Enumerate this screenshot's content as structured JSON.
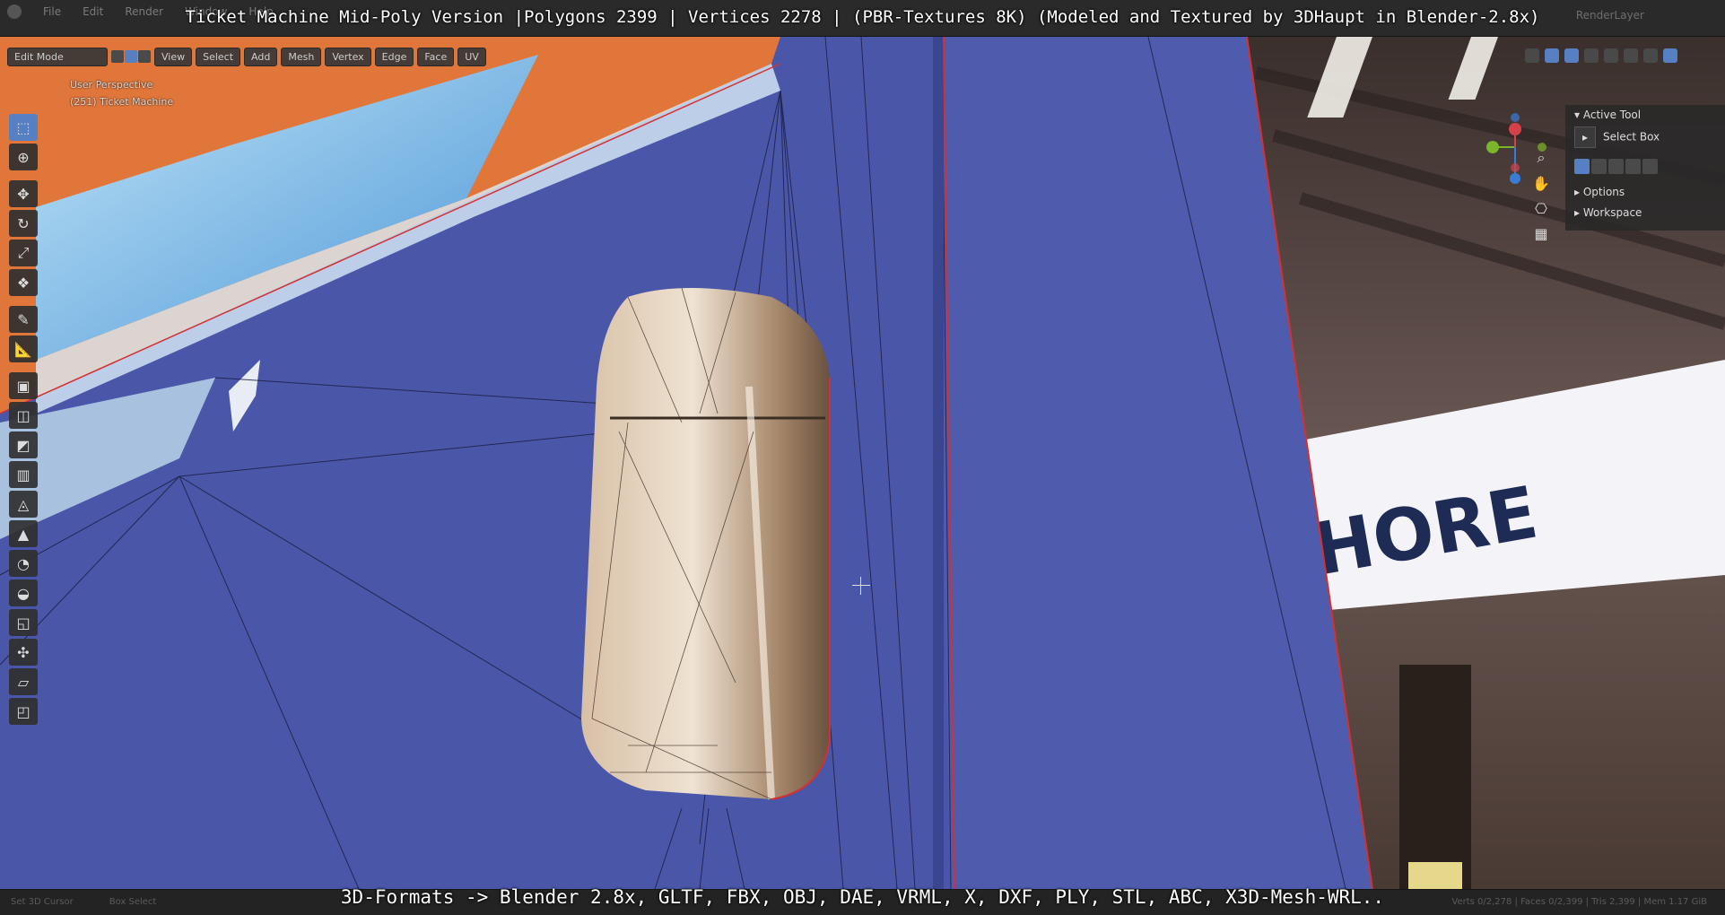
{
  "overlay": {
    "title": "Ticket Machine Mid-Poly Version |Polygons 2399 | Vertices 2278 | (PBR-Textures 8K) (Modeled and Textured by 3DHaupt in Blender-2.8x)",
    "formats": "3D-Formats -> Blender 2.8x, GLTF, FBX, OBJ, DAE, VRML, X, DXF, PLY, STL, ABC, X3D-Mesh-WRL.."
  },
  "menu": {
    "items": [
      "File",
      "Edit",
      "Render",
      "Window",
      "Help"
    ]
  },
  "top_right": {
    "renderlayer": "RenderLayer"
  },
  "header": {
    "mode": "Edit Mode",
    "buttons": [
      "View",
      "Select",
      "Add",
      "Mesh",
      "Vertex",
      "Edge",
      "Face",
      "UV"
    ]
  },
  "viewport": {
    "perspective": "User Perspective",
    "object": "(251) Ticket Machine",
    "sign_text": "HORE",
    "background": "#4a57a8"
  },
  "toolbar": {
    "tools": [
      "select-box",
      "cursor",
      "move",
      "rotate",
      "scale",
      "transform",
      "annotate",
      "measure",
      "extrude",
      "inset",
      "bevel",
      "loop-cut",
      "knife",
      "poly-build",
      "spin",
      "smooth",
      "edge-slide",
      "shrink-fatten",
      "shear",
      "rip"
    ]
  },
  "npanel": {
    "active_tool": "Active Tool",
    "select_box": "Select Box",
    "options": "Options",
    "workspace": "Workspace"
  },
  "status": {
    "left1": "Set 3D Cursor",
    "left2": "Box Select",
    "right": "Verts 0/2,278 | Faces 0/2,399 | Tris 2,399 | Mem 1.17 GiB"
  },
  "colors": {
    "accent": "#5680c2",
    "mesh_face": "#4a57a8",
    "edge_seam": "#d53030"
  }
}
